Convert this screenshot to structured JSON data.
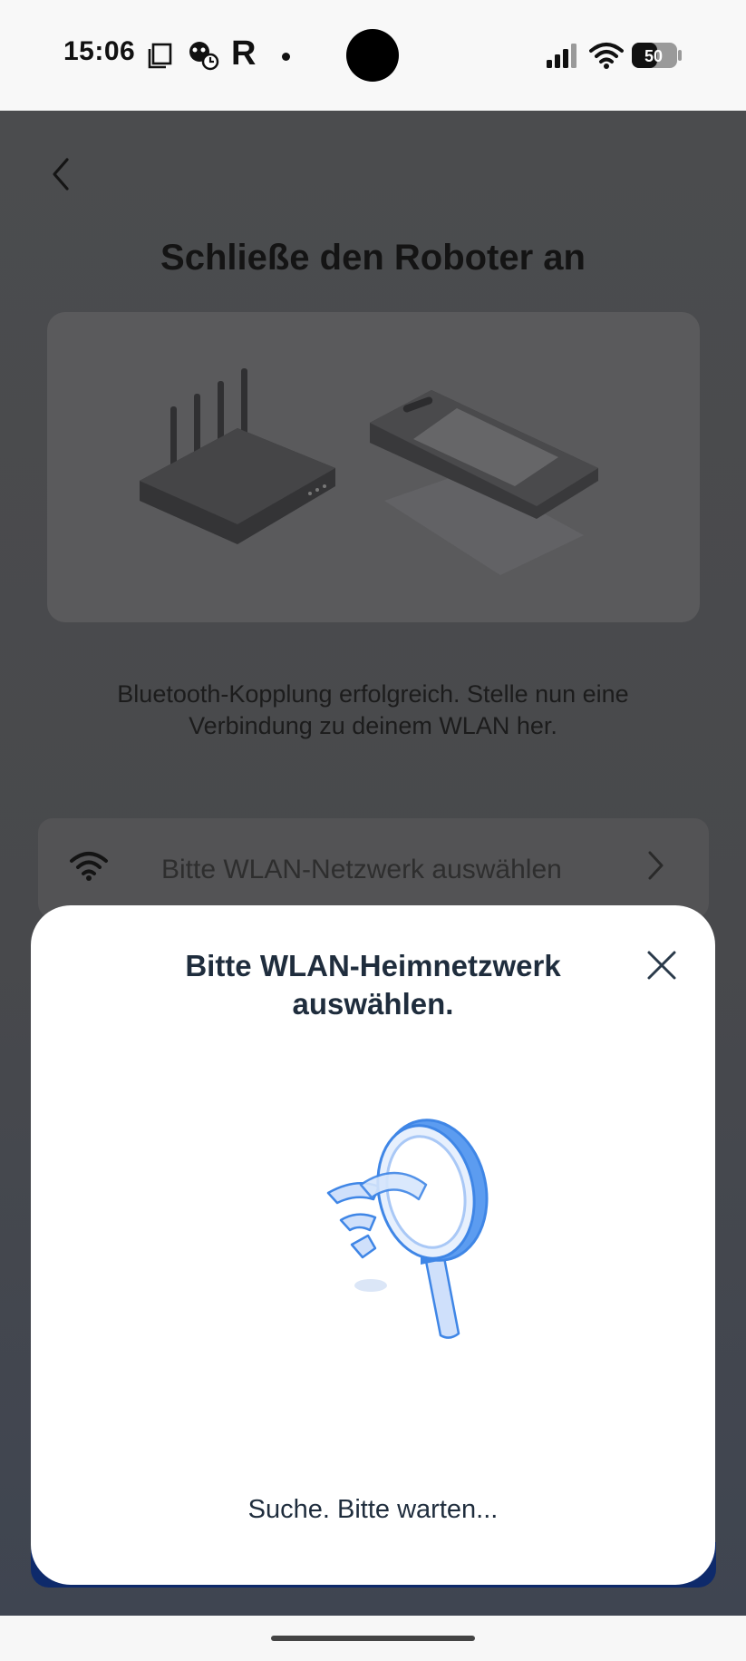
{
  "status_bar": {
    "time": "15:06",
    "letter_icon": "R",
    "battery_level": "50",
    "icons": [
      "screenshot-icon",
      "app-notification-icon",
      "r-app-icon",
      "dot-icon",
      "signal-icon",
      "wifi-icon",
      "battery-icon"
    ]
  },
  "screen": {
    "title": "Schließe den Roboter an",
    "description": "Bluetooth-Kopplung erfolgreich. Stelle nun eine Verbindung zu deinem WLAN her.",
    "wifi_select": {
      "placeholder": "Bitte WLAN-Netzwerk auswählen",
      "icon": "wifi-icon"
    }
  },
  "modal": {
    "title": "Bitte WLAN-Heimnetzwerk auswählen.",
    "status": "Suche. Bitte warten...",
    "close_icon": "close-icon"
  },
  "colors": {
    "accent_blue": "#3f86e6",
    "modal_text": "#1f2d3d",
    "overlay": "#4b4c4e"
  }
}
